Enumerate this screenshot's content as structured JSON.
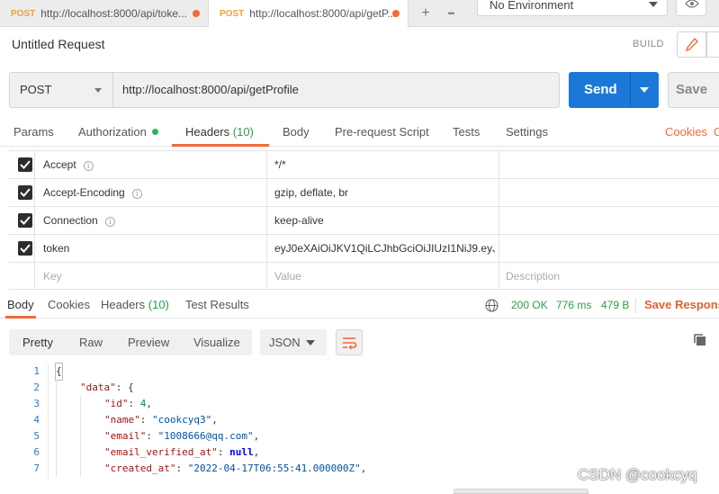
{
  "tabs": [
    {
      "method": "POST",
      "label": "http://localhost:8000/api/toke..."
    },
    {
      "method": "POST",
      "label": "http://localhost:8000/api/getP..."
    }
  ],
  "tab_actions": {
    "new_tab": "+",
    "more": "•••"
  },
  "environment": {
    "selected": "No Environment"
  },
  "request": {
    "title": "Untitled Request",
    "build_label": "BUILD",
    "method": "POST",
    "url": "http://localhost:8000/api/getProfile",
    "send_label": "Send",
    "save_label": "Save"
  },
  "request_tabs": {
    "params": "Params",
    "authorization": "Authorization",
    "headers": "Headers",
    "headers_count": "(10)",
    "body": "Body",
    "pre_request": "Pre-request Script",
    "tests": "Tests",
    "settings": "Settings",
    "cookies": "Cookies",
    "code_partial": "C"
  },
  "headers": {
    "rows": [
      {
        "key": "Accept",
        "value": "*/*",
        "checked": true,
        "info": true
      },
      {
        "key": "Accept-Encoding",
        "value": "gzip, deflate, br",
        "checked": true,
        "info": true
      },
      {
        "key": "Connection",
        "value": "keep-alive",
        "checked": true,
        "info": true
      },
      {
        "key": "token",
        "value": "eyJ0eXAiOiJKV1QiLCJhbGciOiJIUzI1NiJ9.eyJ...",
        "checked": true,
        "info": false
      }
    ],
    "placeholder_key": "Key",
    "placeholder_value": "Value",
    "placeholder_description": "Description"
  },
  "response": {
    "tabs": {
      "body": "Body",
      "cookies": "Cookies",
      "headers": "Headers",
      "headers_count": "(10)",
      "test_results": "Test Results"
    },
    "status": "200 OK",
    "time": "776 ms",
    "size": "479 B",
    "save_response": "Save Response",
    "formats": {
      "pretty": "Pretty",
      "raw": "Raw",
      "preview": "Preview",
      "visualize": "Visualize"
    },
    "language": "JSON"
  },
  "code_lines": [
    {
      "n": "1",
      "indent": 0,
      "key": "",
      "val": "",
      "raw": "{"
    },
    {
      "n": "2",
      "indent": 1,
      "key": "\"data\"",
      "sep": ": ",
      "raw": "{"
    },
    {
      "n": "3",
      "indent": 2,
      "key": "\"id\"",
      "sep": ": ",
      "num": "4",
      "tail": ","
    },
    {
      "n": "4",
      "indent": 2,
      "key": "\"name\"",
      "sep": ": ",
      "str": "\"cookcyq3\"",
      "tail": ","
    },
    {
      "n": "5",
      "indent": 2,
      "key": "\"email\"",
      "sep": ": ",
      "str": "\"1008666@qq.com\"",
      "tail": ","
    },
    {
      "n": "6",
      "indent": 2,
      "key": "\"email_verified_at\"",
      "sep": ": ",
      "kw": "null",
      "tail": ","
    },
    {
      "n": "7",
      "indent": 2,
      "key": "\"created_at\"",
      "sep": ": ",
      "str": "\"2022-04-17T06:55:41.000000Z\"",
      "tail": ","
    }
  ],
  "watermark": "CSDN @cookcyq"
}
